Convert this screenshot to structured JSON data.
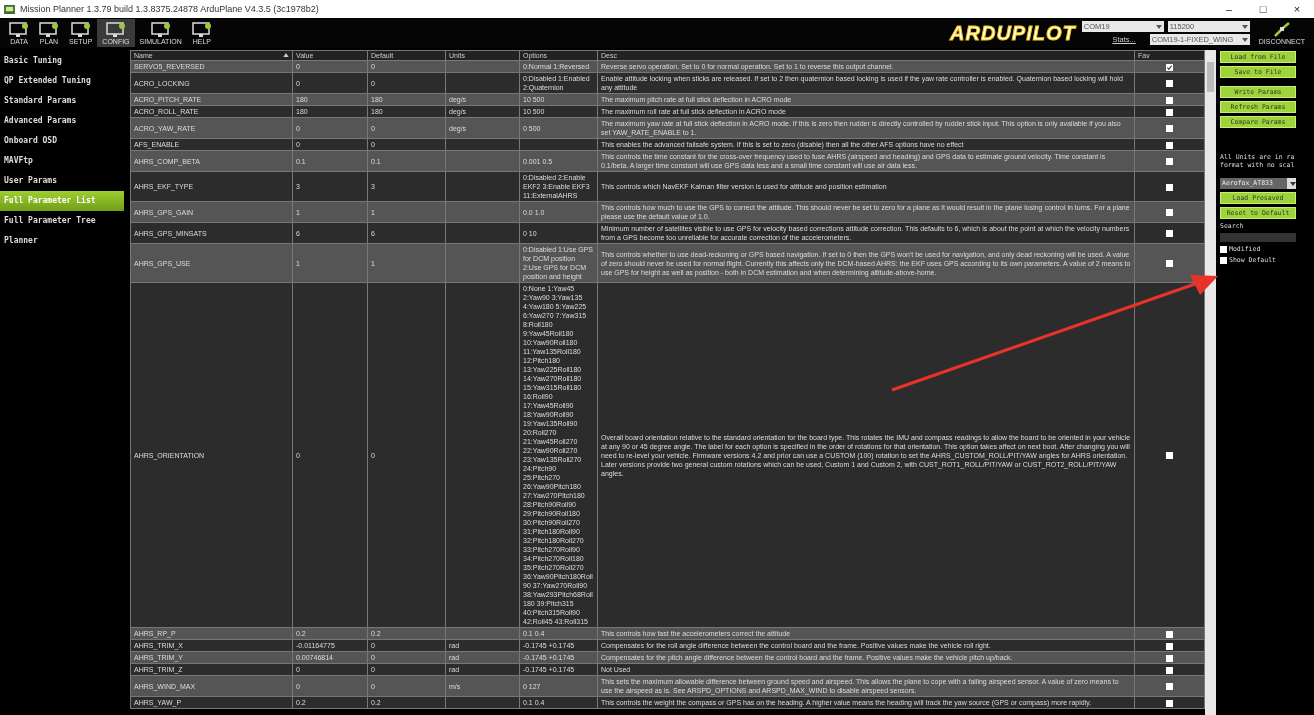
{
  "window": {
    "title": "Mission Planner 1.3.79 build 1.3.8375.24878 ArduPlane V4.3.5 (3c1978b2)",
    "controls": [
      "–",
      "□",
      "×"
    ]
  },
  "toolbar": {
    "items": [
      {
        "label": "DATA",
        "selected": false
      },
      {
        "label": "PLAN",
        "selected": false
      },
      {
        "label": "SETUP",
        "selected": false
      },
      {
        "label": "CONFIG",
        "selected": true
      },
      {
        "label": "SIMULATION",
        "selected": false
      },
      {
        "label": "HELP",
        "selected": false
      }
    ],
    "logo": "ARDUPILOT",
    "port": "COM19",
    "baud": "115200",
    "stats_link": "Stats...",
    "link": "COM19-1-FIXED_WING",
    "connect": "DISCONNECT"
  },
  "sidebar": {
    "items": [
      {
        "label": "Basic Tuning",
        "selected": false
      },
      {
        "label": "QP Extended Tuning",
        "selected": false
      },
      {
        "label": "Standard Params",
        "selected": false
      },
      {
        "label": "Advanced Params",
        "selected": false
      },
      {
        "label": "Onboard OSD",
        "selected": false
      },
      {
        "label": "MAVFtp",
        "selected": false
      },
      {
        "label": "User Params",
        "selected": false
      },
      {
        "label": "Full Parameter List",
        "selected": true
      },
      {
        "label": "Full Parameter Tree",
        "selected": false
      },
      {
        "label": "Planner",
        "selected": false
      }
    ]
  },
  "table": {
    "columns": [
      "Name",
      "Value",
      "Default",
      "Units",
      "Options",
      "Desc",
      "Fav"
    ],
    "rows": [
      {
        "name": "SERVO5_REVERSED",
        "value": "0",
        "default": "0",
        "options": "0:Normal 1:Reversed",
        "desc": "Reverse servo operation. Set to 0 for normal operation. Set to 1 to reverse this output channel.",
        "fav": true
      },
      {
        "name": "ACRO_LOCKING",
        "value": "0",
        "default": "0",
        "options": "0:Disabled 1:Enabled 2:Quaternion",
        "desc": "Enable attitude locking when sticks are released. If set to 2 then quaternion based locking is used if the yaw rate controller is enabled. Quaternion based locking will hold any attitude",
        "fav": false
      },
      {
        "name": "ACRO_PITCH_RATE",
        "value": "180",
        "default": "180",
        "units": "deg/s",
        "options": "10 500",
        "desc": "The maximum pitch rate at full stick deflection in ACRO mode",
        "fav": false
      },
      {
        "name": "ACRO_ROLL_RATE",
        "value": "180",
        "default": "180",
        "units": "deg/s",
        "options": "10 500",
        "desc": "The maximum roll rate at full stick deflection in ACRO mode",
        "fav": false
      },
      {
        "name": "ACRO_YAW_RATE",
        "value": "0",
        "default": "0",
        "units": "deg/s",
        "options": "0 500",
        "desc": "The maximum yaw rate at full stick deflection in ACRO mode. If this is zero then rudder is directly controlled by rudder stick input. This option is only available if you also set YAW_RATE_ENABLE to 1.",
        "fav": false
      },
      {
        "name": "AFS_ENABLE",
        "value": "0",
        "default": "0",
        "desc": "This enables the advanced failsafe system. If this is set to zero (disable) then all the other AFS options have no effect",
        "fav": false
      },
      {
        "name": "AHRS_COMP_BETA",
        "value": "0.1",
        "default": "0.1",
        "options": "0.001 0.5",
        "desc": "This controls the time constant for the cross-over frequency used to fuse AHRS (airspeed and heading) and GPS data to estimate ground velocity. Time constant is 0.1/beta. A larger time constant will use GPS data less and a small time constant will use air data less.",
        "fav": false
      },
      {
        "name": "AHRS_EKF_TYPE",
        "value": "3",
        "default": "3",
        "options": "0:Disabled 2:Enable EKF2 3:Enable EKF3 11:ExternalAHRS",
        "desc": "This controls which NavEKF Kalman filter version is used for attitude and position estimation",
        "fav": false
      },
      {
        "name": "AHRS_GPS_GAIN",
        "value": "1",
        "default": "1",
        "options": "0.0 1.0",
        "desc": "This controls how much to use the GPS to correct the attitude. This should never be set to zero for a plane as it would result in the plane losing control in turns. For a plane please use the default value of 1.0.",
        "fav": false
      },
      {
        "name": "AHRS_GPS_MINSATS",
        "value": "6",
        "default": "6",
        "options": "0 10",
        "desc": "Minimum number of satellites visible to use GPS for velocity based corrections attitude correction. This defaults to 6, which is about the point at which the velocity numbers from a GPS become too unreliable for accurate correction of the accelerometers.",
        "fav": false
      },
      {
        "name": "AHRS_GPS_USE",
        "value": "1",
        "default": "1",
        "options": "0:Disabled 1:Use GPS for DCM position 2:Use GPS for DCM position and height",
        "desc": "This controls whether to use dead-reckoning or GPS based navigation. If set to 0 then the GPS won't be used for navigation, and only dead reckoning will be used. A value of zero should never be used for normal flight. Currently this affects only the DCM-based AHRS: the EKF uses GPS according to its own parameters. A value of 2 means to use GPS for height as well as position - both in DCM estimation and when determining altitude-above-home.",
        "fav": false
      },
      {
        "name": "AHRS_ORIENTATION",
        "value": "0",
        "default": "0",
        "options": "0:None 1:Yaw45 2:Yaw90 3:Yaw135 4:Yaw180 5:Yaw225 6:Yaw270 7:Yaw315 8:Roll180 9:Yaw45Roll180 10:Yaw90Roll180 11:Yaw135Roll180 12:Pitch180 13:Yaw225Roll180 14:Yaw270Roll180 15:Yaw315Roll180 16:Roll90 17:Yaw45Roll90 18:Yaw90Roll90 19:Yaw135Roll90 20:Roll270 21:Yaw45Roll270 22:Yaw90Roll270 23:Yaw135Roll270 24:Pitch90 25:Pitch270 26:Yaw90Pitch180 27:Yaw270Pitch180 28:Pitch90Roll90 29:Pitch90Roll180 30:Pitch90Roll270 31:Pitch180Roll90 32:Pitch180Roll270 33:Pitch270Roll90 34:Pitch270Roll180 35:Pitch270Roll270 36:Yaw90Pitch180Roll90 37:Yaw270Roll90 38:Yaw293Pitch68Roll180 39:Pitch315 40:Pitch315Roll90 42:Roll45 43:Roll315",
        "desc": "Overall board orientation relative to the standard orientation for the board type. This rotates the IMU and compass readings to allow the board to be oriented in your vehicle at any 90 or 45 degree angle. The label for each option is specified in the order of rotations for that orientation. This option takes affect on next boot. After changing you will need to re-level your vehicle. Firmware versions 4.2 and prior can use a CUSTOM (100) rotation to set the AHRS_CUSTOM_ROLL/PIT/YAW angles for AHRS orientation. Later versions provide two general custom rotations which can be used, Custom 1 and Custom 2, with CUST_ROT1_ROLL/PIT/YAW or CUST_ROT2_ROLL/PIT/YAW angles.",
        "fav": false
      },
      {
        "name": "AHRS_RP_P",
        "value": "0.2",
        "default": "0.2",
        "options": "0.1 0.4",
        "desc": "This controls how fast the accelerometers correct the attitude",
        "fav": false
      },
      {
        "name": "AHRS_TRIM_X",
        "value": "-0.01164775",
        "default": "0",
        "units": "rad",
        "options": "-0.1745 +0.1745",
        "desc": "Compensates for the roll angle difference between the control board and the frame. Positive values make the vehicle roll right.",
        "fav": false
      },
      {
        "name": "AHRS_TRIM_Y",
        "value": "0.00746814",
        "default": "0",
        "units": "rad",
        "options": "-0.1745 +0.1745",
        "desc": "Compensates for the pitch angle difference between the control board and the frame. Positive values make the vehicle pitch up/back.",
        "fav": false
      },
      {
        "name": "AHRS_TRIM_Z",
        "value": "0",
        "default": "0",
        "units": "rad",
        "options": "-0.1745 +0.1745",
        "desc": "Not Used",
        "fav": false
      },
      {
        "name": "AHRS_WIND_MAX",
        "value": "0",
        "default": "0",
        "units": "m/s",
        "options": "0 127",
        "desc": "This sets the maximum allowable difference between ground speed and airspeed. This allows the plane to cope with a failing airspeed sensor. A value of zero means to use the airspeed as is. See ARSPD_OPTIONS and ARSPD_MAX_WIND to disable airspeed sensors.",
        "fav": false
      },
      {
        "name": "AHRS_YAW_P",
        "value": "0.2",
        "default": "0.2",
        "options": "0.1 0.4",
        "desc": "This controls the weight the compass or GPS has on the heading. A higher value means the heading will track the yaw source (GPS or compass) more rapidly.",
        "fav": false
      }
    ]
  },
  "panel": {
    "buttons_top": [
      "Load from File",
      "Save to File",
      "Write Params",
      "Refresh Params",
      "Compare Params"
    ],
    "note": [
      "All Units are in ra",
      "format with no scal"
    ],
    "preset": "Aerofox_AT833",
    "buttons_bottom": [
      "Load Presaved",
      "Reset to Default"
    ],
    "search_label": "Search",
    "checks": [
      {
        "label": "Modified",
        "checked": false
      },
      {
        "label": "Show Default",
        "checked": false
      }
    ]
  }
}
